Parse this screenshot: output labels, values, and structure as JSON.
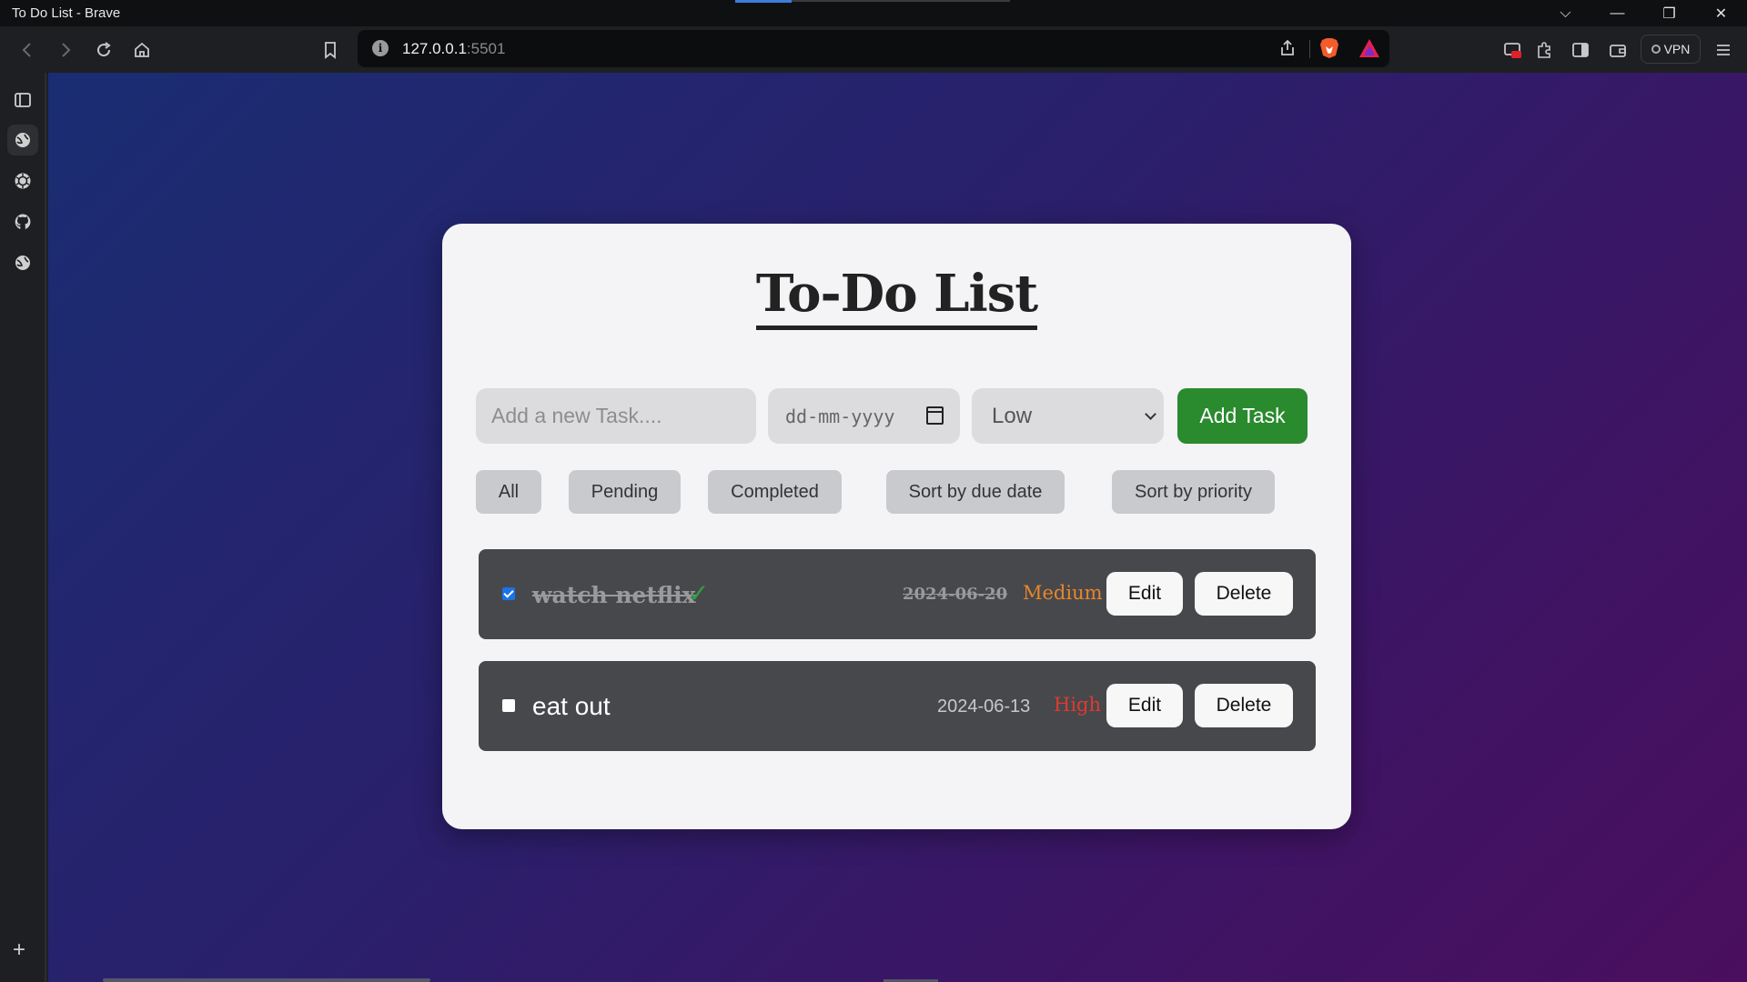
{
  "window": {
    "title": "To Do List - Brave",
    "controls": {
      "dropdown": "⌵",
      "minimize": "—",
      "restore": "❐",
      "close": "✕"
    }
  },
  "toolbar": {
    "url_host": "127.0.0.1",
    "url_port": ":5501",
    "vpn_label": "VPN"
  },
  "sidebar": {
    "items": [
      "sidebar-toggle",
      "web-panel",
      "chatgpt",
      "github",
      "web-panel-2"
    ],
    "add_label": "+"
  },
  "app": {
    "title": "To-Do List",
    "form": {
      "task_placeholder": "Add a new Task....",
      "date_placeholder": "dd-mm-yyyy",
      "priority_selected": "Low",
      "add_label": "Add Task"
    },
    "filters": [
      {
        "label": "All"
      },
      {
        "label": "Pending"
      },
      {
        "label": "Completed"
      },
      {
        "label": "Sort by due date"
      },
      {
        "label": "Sort by priority"
      }
    ],
    "tasks": [
      {
        "name": "watch netflix",
        "completed": true,
        "check_mark": "✓",
        "due": "2024-06-20",
        "priority": "Medium",
        "priority_color": "#e8862a",
        "edit_label": "Edit",
        "delete_label": "Delete"
      },
      {
        "name": "eat out",
        "completed": false,
        "due": "2024-06-13",
        "priority": "High",
        "priority_color": "#e03a2e",
        "edit_label": "Edit",
        "delete_label": "Delete"
      }
    ]
  },
  "colors": {
    "add_button": "#2a8a2e",
    "card_bg": "#f4f4f6",
    "task_bg": "#47484c"
  }
}
